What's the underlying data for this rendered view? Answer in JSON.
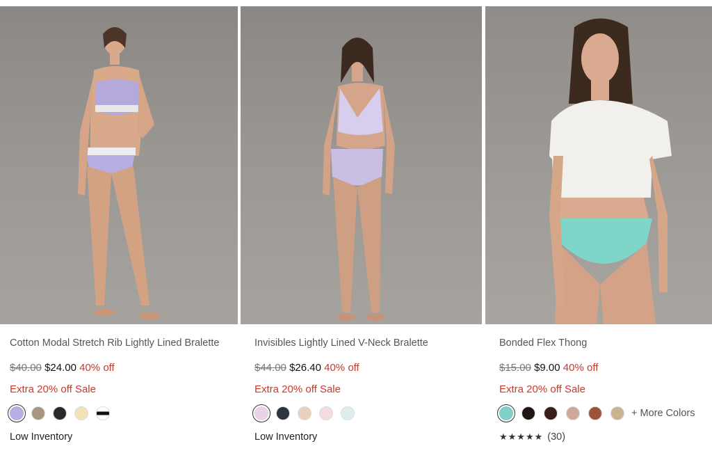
{
  "products": [
    {
      "title": "Cotton Modal Stretch Rib Lightly Lined Bralette",
      "price_original": "$40.00",
      "price_sale": "$24.00",
      "discount": "40% off",
      "promo": "Extra 20% off Sale",
      "swatches": [
        "#b9aee3",
        "#a8977f",
        "#2a2a2a",
        "#f1e3b6",
        "stripe"
      ],
      "inventory": "Low Inventory"
    },
    {
      "title": "Invisibles Lightly Lined V-Neck Bralette",
      "price_original": "$44.00",
      "price_sale": "$26.40",
      "discount": "40% off",
      "promo": "Extra 20% off Sale",
      "swatches": [
        "#e9d3ea",
        "#2c3440",
        "#e9d1bd",
        "#f4dde0",
        "#dcefee"
      ],
      "inventory": "Low Inventory"
    },
    {
      "title": "Bonded Flex Thong",
      "price_original": "$15.00",
      "price_sale": "$9.00",
      "discount": "40% off",
      "promo": "Extra 20% off Sale",
      "swatches": [
        "#7fd0c6",
        "#1e1614",
        "#3b1e1a",
        "#cfa899",
        "#9a5439",
        "#c8b48e"
      ],
      "more_colors": "+ More Colors",
      "rating_stars": "★★★★★",
      "rating_count": "(30)"
    }
  ]
}
